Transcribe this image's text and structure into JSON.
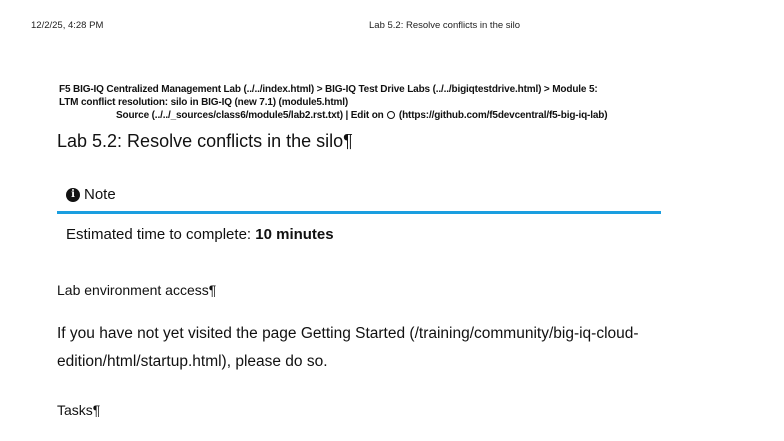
{
  "print_header": {
    "datetime": "12/2/25, 4:28 PM",
    "doc_title": "Lab 5.2: Resolve conflicts in the silo"
  },
  "breadcrumb": {
    "line1": "F5 BIG-IQ Centralized Management Lab (../../index.html) > BIG-IQ Test Drive Labs (../../bigiqtestdrive.html) > Module 5:",
    "line2": "LTM conflict resolution: silo in BIG-IQ (new 7.1) (module5.html)",
    "source": "Source (../../_sources/class6/module5/lab2.rst.txt) | Edit on",
    "github_link": "(https://github.com/f5devcentral/f5-big-iq-lab)",
    "icon": "github-icon"
  },
  "page_title": "Lab 5.2: Resolve conflicts in the silo¶",
  "note": {
    "icon": "info-icon",
    "icon_glyph": "i",
    "title": "Note",
    "text_prefix": "Estimated time to complete: ",
    "text_bold": "10 minutes",
    "accent_color": "#1a9ee0"
  },
  "sections": {
    "access_heading": "Lab environment access¶",
    "access_text_line1": "If you have not yet visited the page Getting Started (/training/community/big-iq-cloud-",
    "access_text_line2": "edition/html/startup.html), please do so.",
    "tasks_heading": "Tasks¶"
  }
}
